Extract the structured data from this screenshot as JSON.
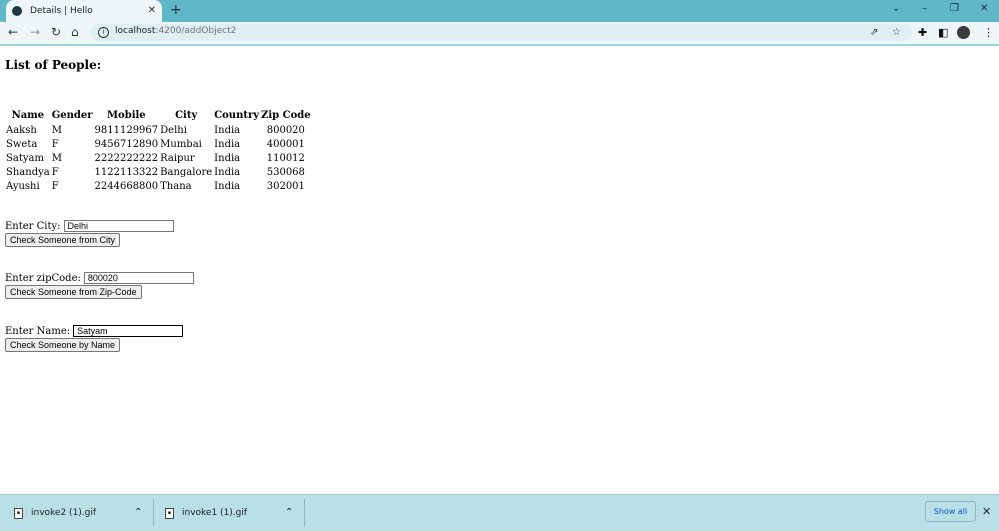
{
  "browser": {
    "tab_title": "Details | Hello",
    "tab_close": "✕",
    "new_tab": "+",
    "url_host": "localhost",
    "url_rest": ":4200/addObject2",
    "window_controls": {
      "chevron": "⌄",
      "minimize": "–",
      "restore": "❐",
      "close": "✕"
    }
  },
  "page": {
    "heading": "List of People:",
    "table": {
      "headers": [
        "Name",
        "Gender",
        "Mobile",
        "City",
        "Country",
        "Zip Code"
      ],
      "rows": [
        [
          "Aaksh",
          "M",
          "9811129967",
          "Delhi",
          "India",
          "800020"
        ],
        [
          "Sweta",
          "F",
          "9456712890",
          "Mumbai",
          "India",
          "400001"
        ],
        [
          "Satyam",
          "M",
          "2222222222",
          "Raipur",
          "India",
          "110012"
        ],
        [
          "Shandya",
          "F",
          "1122113322",
          "Bangalore",
          "India",
          "530068"
        ],
        [
          "Ayushi",
          "F",
          "2244668800",
          "Thana",
          "India",
          "302001"
        ]
      ]
    },
    "city_form": {
      "label": "Enter City:",
      "value": "Delhi",
      "button": "Check Someone from City"
    },
    "zip_form": {
      "label": "Enter zipCode:",
      "value": "800020",
      "button": "Check Someone from Zip-Code"
    },
    "name_form": {
      "label": "Enter Name:",
      "value": "Satyam",
      "button": "Check Someone by Name"
    }
  },
  "downloads": {
    "items": [
      {
        "name": "invoke2 (1).gif"
      },
      {
        "name": "invoke1 (1).gif"
      }
    ],
    "show_all": "Show all",
    "close": "✕"
  }
}
